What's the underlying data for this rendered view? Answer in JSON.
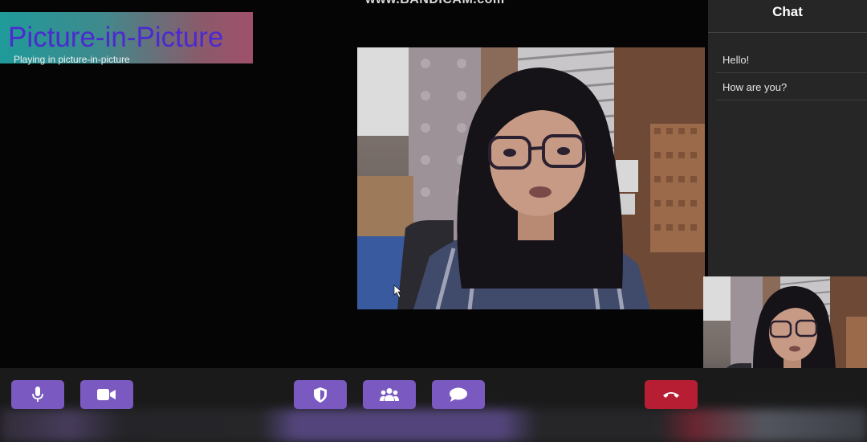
{
  "watermark": {
    "text": "www.BANDICAM.com"
  },
  "pip": {
    "title": "Picture-in-Picture",
    "subtitle": "Playing in picture-in-picture"
  },
  "chat": {
    "title": "Chat",
    "messages": [
      "Hello!",
      "How are you?"
    ]
  },
  "toolbar": {
    "buttons": [
      {
        "icon": "microphone-icon",
        "color": "#7a5ac0"
      },
      {
        "icon": "video-camera-icon",
        "color": "#7a5ac0"
      },
      {
        "icon": "shield-icon",
        "color": "#7a5ac0"
      },
      {
        "icon": "participants-icon",
        "color": "#7a5ac0"
      },
      {
        "icon": "chat-bubble-icon",
        "color": "#7a5ac0"
      },
      {
        "icon": "hang-up-icon",
        "color": "#b81e33"
      }
    ]
  },
  "colors": {
    "accent": "#7a5ac0",
    "end_call": "#b81e33",
    "chat_panel": "#262626",
    "pip_title": "#4b2ad0"
  }
}
